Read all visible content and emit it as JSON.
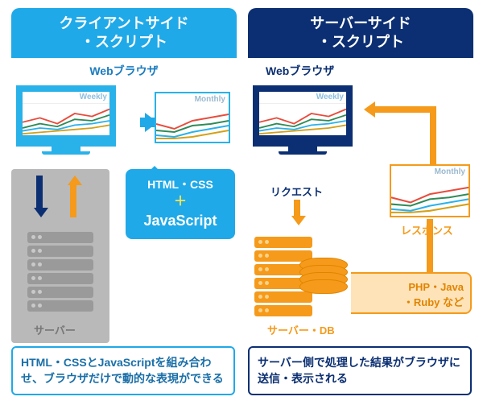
{
  "left": {
    "title_l1": "クライアントサイド",
    "title_l2": "・スクリプト",
    "browser_label": "Webブラウザ",
    "panel_weekly": "Weekly",
    "panel_monthly": "Monthly",
    "bubble_line1": "HTML・CSS",
    "bubble_plus": "＋",
    "bubble_js": "JavaScript",
    "server_label": "サーバー",
    "caption": "HTML・CSSとJavaScriptを組み合わせ、ブラウザだけで動的な表現ができる"
  },
  "right": {
    "title_l1": "サーバーサイド",
    "title_l2": "・スクリプト",
    "browser_label": "Webブラウザ",
    "panel_weekly": "Weekly",
    "panel_monthly": "Monthly",
    "request_label": "リクエスト",
    "response_label": "レスポンス",
    "serverdb_label": "サーバー・DB",
    "langs_l1": "PHP・Java",
    "langs_l2": "・Ruby など",
    "caption": "サーバー側で処理した結果がブラウザに送信・表示される"
  }
}
